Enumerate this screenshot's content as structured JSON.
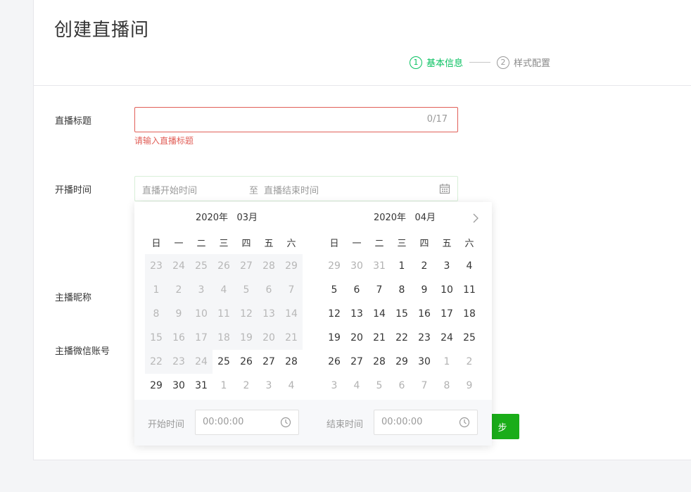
{
  "page_title": "创建直播间",
  "steps": [
    {
      "num": "1",
      "label": "基本信息"
    },
    {
      "num": "2",
      "label": "样式配置"
    }
  ],
  "form": {
    "title_label": "直播标题",
    "title_counter": "0/17",
    "title_error": "请输入直播标题",
    "time_label": "开播时间",
    "start_placeholder": "直播开始时间",
    "range_separator": "至",
    "end_placeholder": "直播结束时间",
    "nickname_label": "主播昵称",
    "wechat_label": "主播微信账号",
    "next_button_partial": "步"
  },
  "datepicker": {
    "left": {
      "year": "2020年",
      "month": "03月",
      "weekdays": [
        "日",
        "一",
        "二",
        "三",
        "四",
        "五",
        "六"
      ],
      "days": [
        [
          "23",
          "24",
          "25",
          "26",
          "27",
          "28",
          "29"
        ],
        [
          "1",
          "2",
          "3",
          "4",
          "5",
          "6",
          "7"
        ],
        [
          "8",
          "9",
          "10",
          "11",
          "12",
          "13",
          "14"
        ],
        [
          "15",
          "16",
          "17",
          "18",
          "19",
          "20",
          "21"
        ],
        [
          "22",
          "23",
          "24",
          "25",
          "26",
          "27",
          "28"
        ],
        [
          "29",
          "30",
          "31",
          "1",
          "2",
          "3",
          "4"
        ]
      ]
    },
    "right": {
      "year": "2020年",
      "month": "04月",
      "weekdays": [
        "日",
        "一",
        "二",
        "三",
        "四",
        "五",
        "六"
      ],
      "days": [
        [
          "29",
          "30",
          "31",
          "1",
          "2",
          "3",
          "4"
        ],
        [
          "5",
          "6",
          "7",
          "8",
          "9",
          "10",
          "11"
        ],
        [
          "12",
          "13",
          "14",
          "15",
          "16",
          "17",
          "18"
        ],
        [
          "19",
          "20",
          "21",
          "22",
          "23",
          "24",
          "25"
        ],
        [
          "26",
          "27",
          "28",
          "29",
          "30",
          "1",
          "2"
        ],
        [
          "3",
          "4",
          "5",
          "6",
          "7",
          "8",
          "9"
        ]
      ]
    },
    "start_time_label": "开始时间",
    "start_time_value": "00:00:00",
    "end_time_label": "结束时间",
    "end_time_value": "00:00:00"
  },
  "colors": {
    "accent": "#07c160",
    "button": "#1aad19",
    "error": "#e15f58"
  },
  "icons": {
    "calendar": "calendar-icon",
    "clock": "clock-icon",
    "next_month": "chevron-right-icon"
  }
}
